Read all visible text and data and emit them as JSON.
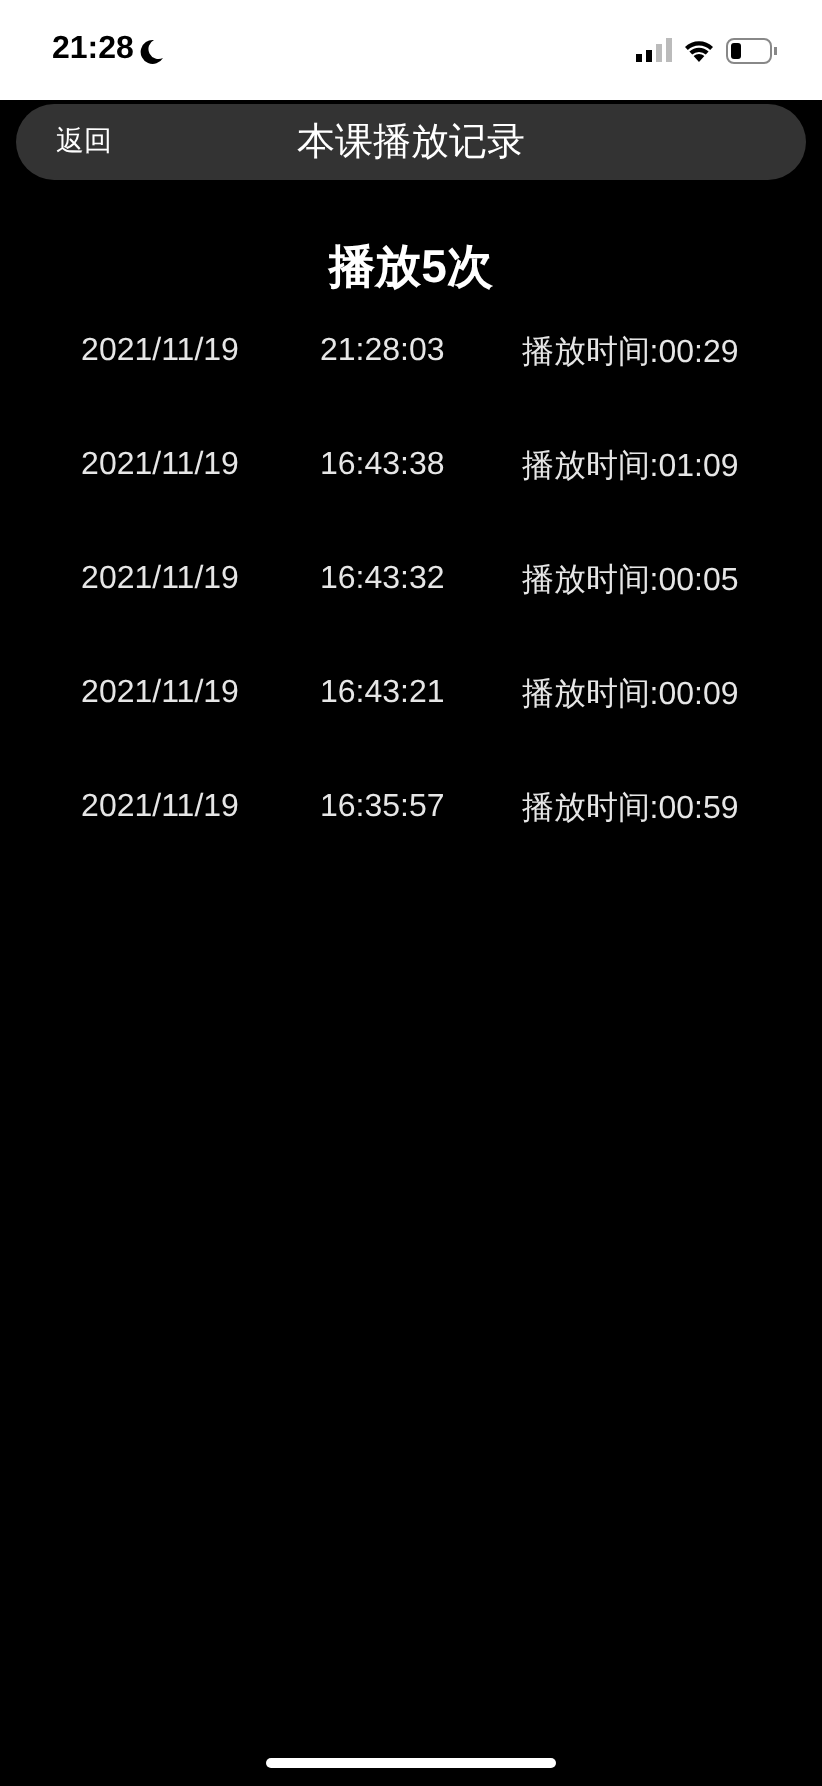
{
  "status_bar": {
    "time": "21:28"
  },
  "nav_bar": {
    "back": "返回",
    "title": "本课播放记录"
  },
  "summary": "播放5次",
  "records": [
    {
      "date": "2021/11/19",
      "time": "21:28:03",
      "duration": "播放时间:00:29"
    },
    {
      "date": "2021/11/19",
      "time": "16:43:38",
      "duration": "播放时间:01:09"
    },
    {
      "date": "2021/11/19",
      "time": "16:43:32",
      "duration": "播放时间:00:05"
    },
    {
      "date": "2021/11/19",
      "time": "16:43:21",
      "duration": "播放时间:00:09"
    },
    {
      "date": "2021/11/19",
      "time": "16:35:57",
      "duration": "播放时间:00:59"
    }
  ]
}
